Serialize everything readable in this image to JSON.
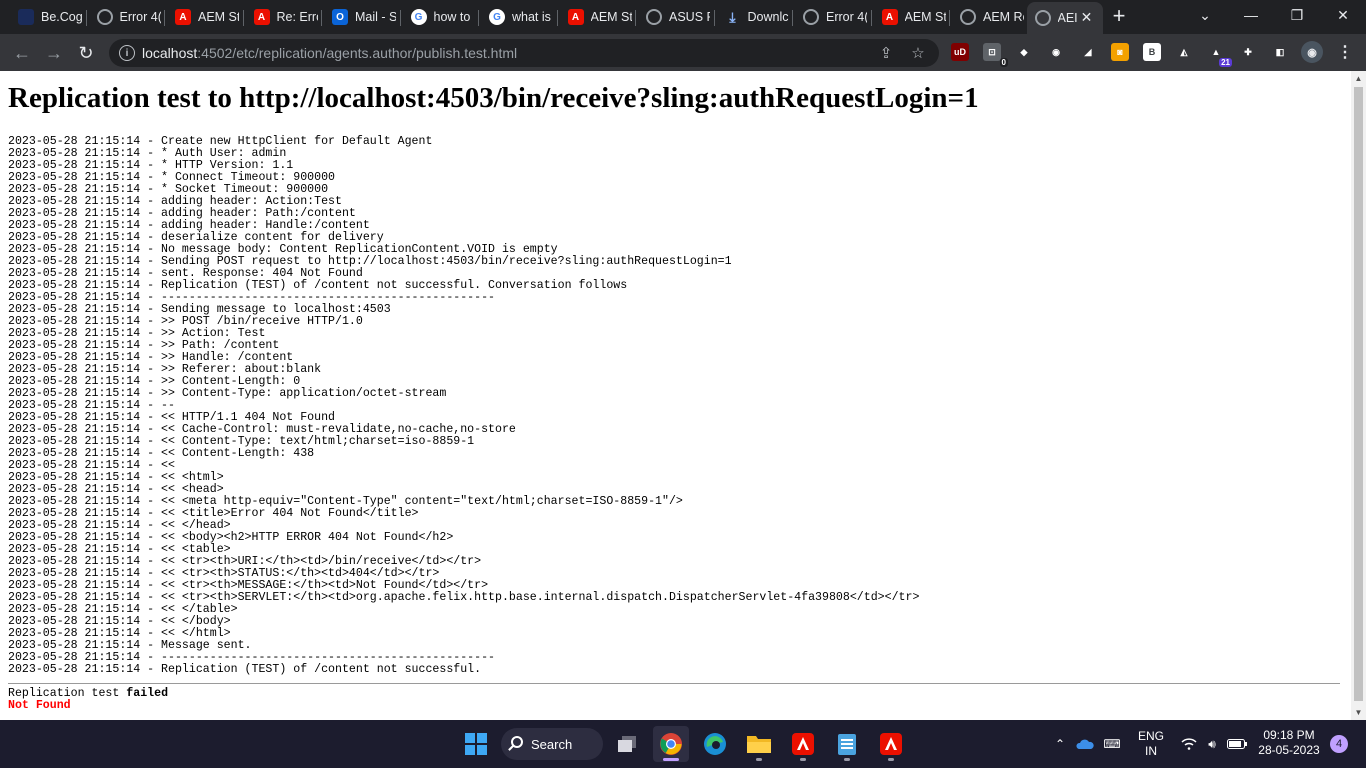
{
  "browser": {
    "tabs": [
      {
        "title": "Be.Cog",
        "icon": "be-icon",
        "active": false
      },
      {
        "title": "Error 4(",
        "icon": "globe-icon",
        "active": false
      },
      {
        "title": "AEM St",
        "icon": "adobe-icon",
        "active": false
      },
      {
        "title": "Re: Errc",
        "icon": "adobe-icon",
        "active": false
      },
      {
        "title": "Mail - S",
        "icon": "outlook-icon",
        "active": false
      },
      {
        "title": "how to",
        "icon": "google-icon",
        "active": false
      },
      {
        "title": "what is",
        "icon": "google-icon",
        "active": false
      },
      {
        "title": "AEM St",
        "icon": "adobe-icon",
        "active": false
      },
      {
        "title": "ASUS F",
        "icon": "globe-icon",
        "active": false
      },
      {
        "title": "Downlc",
        "icon": "download-icon",
        "active": false
      },
      {
        "title": "Error 4(",
        "icon": "globe-icon",
        "active": false
      },
      {
        "title": "AEM St",
        "icon": "adobe-icon",
        "active": false
      },
      {
        "title": "AEM Re",
        "icon": "globe-icon",
        "active": false
      },
      {
        "title": "AEI",
        "icon": "globe-icon",
        "active": true
      }
    ],
    "new_tab_label": "+",
    "url": {
      "host": "localhost",
      "rest": ":4502/etc/replication/agents.author/publish.test.html"
    },
    "extensions": [
      {
        "name": "ublock-icon",
        "label": "uD",
        "color": "#800000"
      },
      {
        "name": "tab-counter-icon",
        "label": "⊡",
        "color": "#5f6368",
        "badge": "0"
      },
      {
        "name": "diamond-icon",
        "label": "◆",
        "color": "#35363a"
      },
      {
        "name": "owl-icon",
        "label": "◉",
        "color": "#35363a"
      },
      {
        "name": "eraser-icon",
        "label": "◢",
        "color": "#35363a"
      },
      {
        "name": "camera-ext-icon",
        "label": "◙",
        "color": "#f4a100"
      },
      {
        "name": "bold-b-icon",
        "label": "B",
        "color": "#ffffff"
      },
      {
        "name": "fox-icon",
        "label": "◭",
        "color": "#35363a"
      },
      {
        "name": "grad-cap-icon",
        "label": "▲",
        "color": "#35363a",
        "badge": "21"
      },
      {
        "name": "puzzle-icon",
        "label": "✚",
        "color": "#35363a"
      },
      {
        "name": "side-panel-icon",
        "label": "◧",
        "color": "#35363a"
      }
    ]
  },
  "page": {
    "title": "Replication test to http://localhost:4503/bin/receive?sling:authRequestLogin=1",
    "log": [
      "2023-05-28 21:15:14 - Create new HttpClient for Default Agent",
      "2023-05-28 21:15:14 - * Auth User: admin",
      "2023-05-28 21:15:14 - * HTTP Version: 1.1",
      "2023-05-28 21:15:14 - * Connect Timeout: 900000",
      "2023-05-28 21:15:14 - * Socket Timeout: 900000",
      "2023-05-28 21:15:14 - adding header: Action:Test",
      "2023-05-28 21:15:14 - adding header: Path:/content",
      "2023-05-28 21:15:14 - adding header: Handle:/content",
      "2023-05-28 21:15:14 - deserialize content for delivery",
      "2023-05-28 21:15:14 - No message body: Content ReplicationContent.VOID is empty",
      "2023-05-28 21:15:14 - Sending POST request to http://localhost:4503/bin/receive?sling:authRequestLogin=1",
      "2023-05-28 21:15:14 - sent. Response: 404 Not Found",
      "2023-05-28 21:15:14 - Replication (TEST) of /content not successful. Conversation follows",
      "2023-05-28 21:15:14 - ------------------------------------------------",
      "2023-05-28 21:15:14 - Sending message to localhost:4503",
      "2023-05-28 21:15:14 - >> POST /bin/receive HTTP/1.0",
      "2023-05-28 21:15:14 - >> Action: Test",
      "2023-05-28 21:15:14 - >> Path: /content",
      "2023-05-28 21:15:14 - >> Handle: /content",
      "2023-05-28 21:15:14 - >> Referer: about:blank",
      "2023-05-28 21:15:14 - >> Content-Length: 0",
      "2023-05-28 21:15:14 - >> Content-Type: application/octet-stream",
      "2023-05-28 21:15:14 - --",
      "2023-05-28 21:15:14 - << HTTP/1.1 404 Not Found",
      "2023-05-28 21:15:14 - << Cache-Control: must-revalidate,no-cache,no-store",
      "2023-05-28 21:15:14 - << Content-Type: text/html;charset=iso-8859-1",
      "2023-05-28 21:15:14 - << Content-Length: 438",
      "2023-05-28 21:15:14 - <<",
      "2023-05-28 21:15:14 - << <html>",
      "2023-05-28 21:15:14 - << <head>",
      "2023-05-28 21:15:14 - << <meta http-equiv=\"Content-Type\" content=\"text/html;charset=ISO-8859-1\"/>",
      "2023-05-28 21:15:14 - << <title>Error 404 Not Found</title>",
      "2023-05-28 21:15:14 - << </head>",
      "2023-05-28 21:15:14 - << <body><h2>HTTP ERROR 404 Not Found</h2>",
      "2023-05-28 21:15:14 - << <table>",
      "2023-05-28 21:15:14 - << <tr><th>URI:</th><td>/bin/receive</td></tr>",
      "2023-05-28 21:15:14 - << <tr><th>STATUS:</th><td>404</td></tr>",
      "2023-05-28 21:15:14 - << <tr><th>MESSAGE:</th><td>Not Found</td></tr>",
      "2023-05-28 21:15:14 - << <tr><th>SERVLET:</th><td>org.apache.felix.http.base.internal.dispatch.DispatcherServlet-4fa39808</td></tr>",
      "2023-05-28 21:15:14 - << </table>",
      "2023-05-28 21:15:14 - << </body>",
      "2023-05-28 21:15:14 - << </html>",
      "2023-05-28 21:15:14 - Message sent.",
      "2023-05-28 21:15:14 - ------------------------------------------------",
      "2023-05-28 21:15:14 - Replication (TEST) of /content not successful."
    ],
    "result_prefix": "Replication test ",
    "result_word": "failed",
    "result_status": "Not Found",
    "status_color": "#ff0000"
  },
  "taskbar": {
    "search_label": "Search",
    "apps": [
      {
        "name": "start-button",
        "icon": "windows-logo-icon"
      },
      {
        "name": "task-view-button",
        "icon": "task-view-icon"
      },
      {
        "name": "chrome-app",
        "icon": "chrome-icon",
        "active": true
      },
      {
        "name": "edge-app",
        "icon": "edge-icon"
      },
      {
        "name": "file-explorer-app",
        "icon": "folder-icon"
      },
      {
        "name": "acrobat-app",
        "icon": "adobe-icon"
      },
      {
        "name": "notepad-app",
        "icon": "notepad-icon"
      },
      {
        "name": "acrobat-app-2",
        "icon": "adobe-icon"
      }
    ],
    "tray": {
      "language": "ENG",
      "region": "IN",
      "time": "09:18 PM",
      "date": "28-05-2023",
      "notifications": "4"
    }
  }
}
